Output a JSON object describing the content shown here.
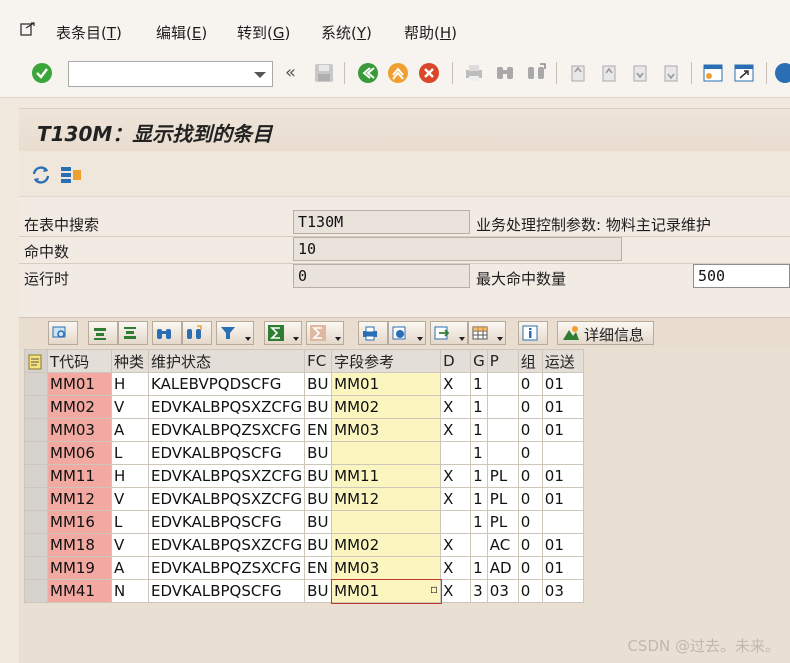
{
  "menu": {
    "items": [
      {
        "label": "表条目(",
        "key": "T",
        "suffix": ")"
      },
      {
        "label": "编辑(",
        "key": "E",
        "suffix": ")"
      },
      {
        "label": "转到(",
        "key": "G",
        "suffix": ")"
      },
      {
        "label": "系统(",
        "key": "Y",
        "suffix": ")"
      },
      {
        "label": "帮助(",
        "key": "H",
        "suffix": ")"
      }
    ]
  },
  "toolbar": {
    "command_value": "",
    "icons": [
      "enter-check-icon",
      "command-dropdown",
      "collapse-icon",
      "save-icon",
      "back-icon",
      "exit-icon",
      "cancel-icon",
      "print-icon",
      "find-icon",
      "find-next-icon",
      "first-page-icon",
      "prev-page-icon",
      "next-page-icon",
      "last-page-icon",
      "new-session-icon",
      "shortcut-icon",
      "help-icon"
    ]
  },
  "title": "T130M：显示找到的条目",
  "form": {
    "search_in_table_label": "在表中搜索",
    "search_in_table_value": "T130M",
    "table_desc": "业务处理控制参数: 物料主记录维护",
    "hits_label": "命中数",
    "hits_value": "10",
    "runtime_label": "运行时",
    "runtime_value": "0",
    "max_hits_label": "最大命中数量",
    "max_hits_value": "500"
  },
  "grid": {
    "detail_label": "详细信息",
    "columns": [
      "T代码",
      "种类",
      "维护状态",
      "FC",
      "字段参考",
      "D",
      "G",
      "P",
      "组",
      "运送"
    ],
    "rows": [
      [
        "MM01",
        "H",
        "KALEBVPQDSCFG",
        "BU",
        "MM01",
        "X",
        "1",
        "",
        "0",
        "01"
      ],
      [
        "MM02",
        "V",
        "EDVKALBPQSXZCFG",
        "BU",
        "MM02",
        "X",
        "1",
        "",
        "0",
        "01"
      ],
      [
        "MM03",
        "A",
        "EDVKALBPQZSXCFG",
        "EN",
        "MM03",
        "X",
        "1",
        "",
        "0",
        "01"
      ],
      [
        "MM06",
        "L",
        "EDVKALBPQSCFG",
        "BU",
        "",
        "",
        "1",
        "",
        "0",
        ""
      ],
      [
        "MM11",
        "H",
        "EDVKALBPQSXZCFG",
        "BU",
        "MM11",
        "X",
        "1",
        "PL",
        "0",
        "01"
      ],
      [
        "MM12",
        "V",
        "EDVKALBPQSXZCFG",
        "BU",
        "MM12",
        "X",
        "1",
        "PL",
        "0",
        "01"
      ],
      [
        "MM16",
        "L",
        "EDVKALBPQSCFG",
        "BU",
        "",
        "",
        "1",
        "PL",
        "0",
        ""
      ],
      [
        "MM18",
        "V",
        "EDVKALBPQSXZCFG",
        "BU",
        "MM02",
        "X",
        "",
        "AC",
        "0",
        "01"
      ],
      [
        "MM19",
        "A",
        "EDVKALBPQZSXCFG",
        "EN",
        "MM03",
        "X",
        "1",
        "AD",
        "0",
        "01"
      ],
      [
        "MM41",
        "N",
        "EDVKALBPQSCFG",
        "BU",
        "MM01",
        "X",
        "3",
        "03",
        "0",
        "03"
      ]
    ]
  },
  "watermark": "CSDN @过去。未来。"
}
